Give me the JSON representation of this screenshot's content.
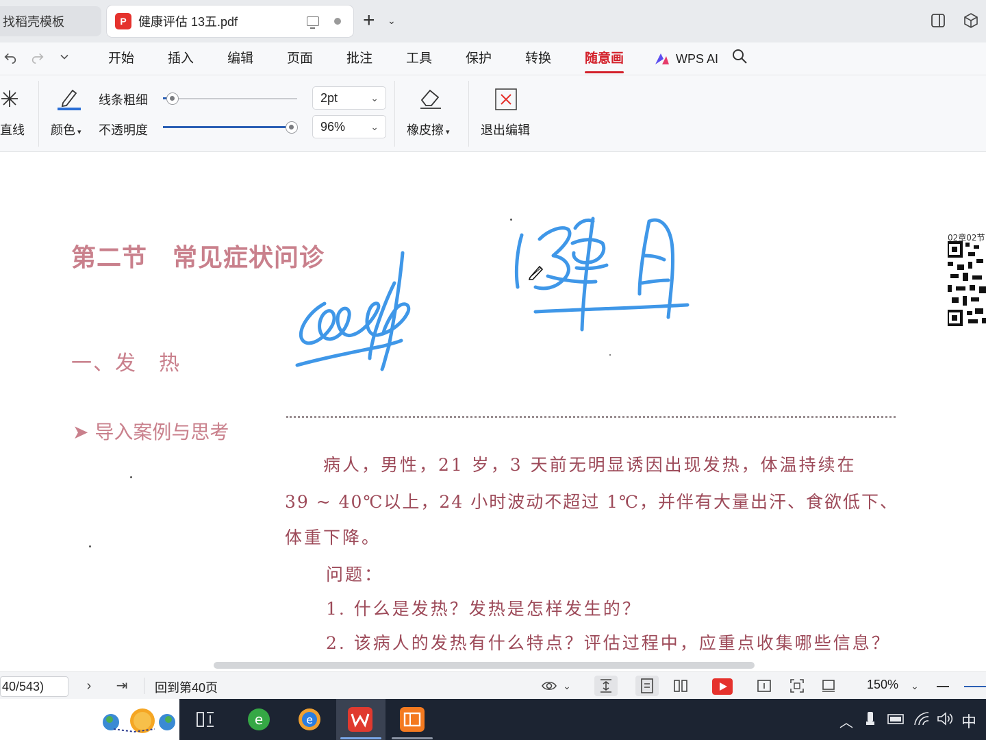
{
  "tabs": {
    "inactive_label": "找稻壳模板",
    "active_label": "健康评估 13五.pdf",
    "new_tab": "+"
  },
  "menu": {
    "items": [
      "开始",
      "插入",
      "编辑",
      "页面",
      "批注",
      "工具",
      "保护",
      "转换",
      "随意画"
    ],
    "active": "随意画",
    "ai_label": "WPS AI"
  },
  "ribbon": {
    "line_tool_label": "直线",
    "color_label": "颜色",
    "thickness_label": "线条粗细",
    "opacity_label": "不透明度",
    "thickness_value": "2pt",
    "opacity_value": "96%",
    "thickness_level": 0.07,
    "opacity_level": 0.96,
    "eraser_label": "橡皮擦",
    "exit_label": "退出编辑",
    "accent_color": "#2b5fb4"
  },
  "document": {
    "section_title": "第二节　常见症状问诊",
    "subsection_title": "一、发　热",
    "case_heading": "导入案例与思考",
    "qr_label": "02章02节",
    "body_lines": [
      "病人，男性，21 岁，3 天前无明显诱因出现发热，体温持续在",
      "39 ~ 40℃以上，24 小时波动不超过 1℃，并伴有大量出汗、食欲低下、",
      "体重下降。",
      "问题：",
      "1.  什么是发热？发热是怎样发生的？",
      "2.  该病人的发热有什么特点？评估过程中，应重点收集哪些信息？"
    ],
    "heading_color": "#c9808c",
    "text_color": "#9d4a59",
    "ink_color": "#3f97e8"
  },
  "status": {
    "page_indicator": "40/543)",
    "back_to_page": "回到第40页",
    "zoom": "150%"
  },
  "taskbar": {
    "ime": "中"
  }
}
